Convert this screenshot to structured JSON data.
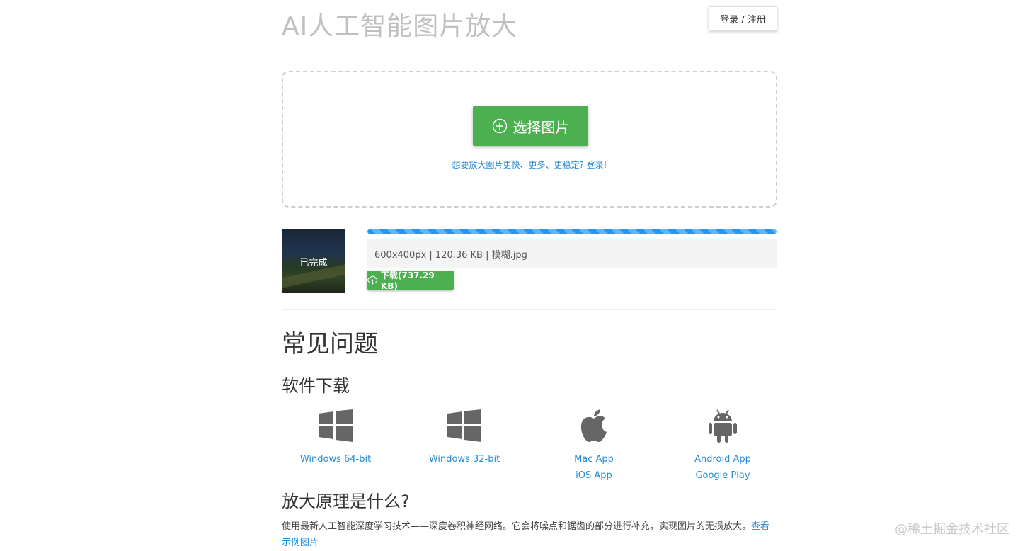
{
  "header": {
    "title": "AI人工智能图片放大",
    "login_label": "登录 / 注册"
  },
  "upload": {
    "select_label": "选择图片",
    "hint": "想要放大图片更快、更多、更稳定? 登录!"
  },
  "result": {
    "status": "已完成",
    "progress": 1.0,
    "info": "600x400px | 120.36 KB | 模糊.jpg",
    "download_label": "下载(737.29 KB)"
  },
  "faq": {
    "title": "常见问题",
    "download_heading": "软件下载",
    "downloads": [
      {
        "icon": "windows-icon",
        "links": [
          "Windows 64-bit"
        ]
      },
      {
        "icon": "windows-icon",
        "links": [
          "Windows 32-bit"
        ]
      },
      {
        "icon": "apple-icon",
        "links": [
          "Mac App",
          "iOS App"
        ]
      },
      {
        "icon": "android-icon",
        "links": [
          "Android App",
          "Google Play"
        ]
      }
    ],
    "principle_heading": "放大原理是什么?",
    "principle_text": "使用最新人工智能深度学习技术——深度卷积神经网络。它会将噪点和锯齿的部分进行补充，实现图片的无损放大。",
    "principle_link": "查看示例图片"
  },
  "watermark": "@稀土掘金技术社区",
  "colors": {
    "primary_green": "#4caf50",
    "link_blue": "#2a8ad0",
    "progress_blue": "#2196f3"
  }
}
